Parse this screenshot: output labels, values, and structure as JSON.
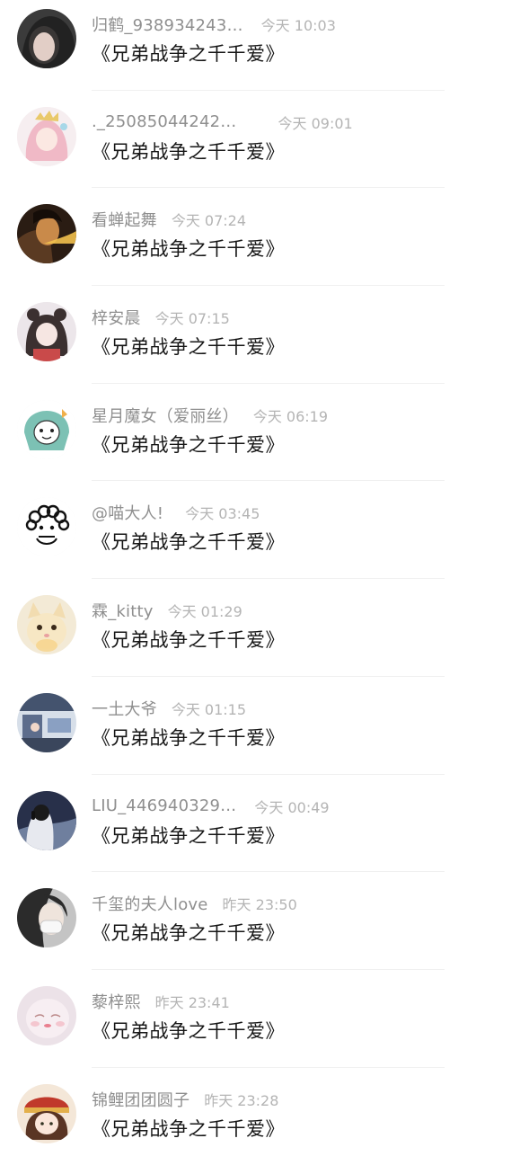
{
  "messages": [
    {
      "name": "归鹤_938934243…",
      "time": "今天 10:03",
      "text": "《兄弟战争之千千爱》",
      "avatar": "photo-dark-hair",
      "avatar_bg": "#3a3a3a",
      "avatar_fg": "#d9c7c0",
      "time_gap": 20
    },
    {
      "name": "._25085044242…",
      "time": "今天 09:01",
      "text": "《兄弟战争之千千爱》",
      "avatar": "anime-pink-hair",
      "avatar_bg": "#f4e6ea",
      "avatar_fg": "#e8a9b8",
      "time_gap": 46
    },
    {
      "name": "看蝉起舞",
      "time": "今天 07:24",
      "text": "《兄弟战争之千千爱》",
      "avatar": "photo-warm-light",
      "avatar_bg": "#2b1d14",
      "avatar_fg": "#e8b24a",
      "time_gap": 16
    },
    {
      "name": "梓安晨",
      "time": "今天 07:15",
      "text": "《兄弟战争之千千爱》",
      "avatar": "anime-bear-hat",
      "avatar_bg": "#e9e3e6",
      "avatar_fg": "#4a3c3c",
      "time_gap": 16
    },
    {
      "name": "星月魔女（爱丽丝）",
      "time": "今天 06:19",
      "text": "《兄弟战争之千千爱》",
      "avatar": "cartoon-teal",
      "avatar_bg": "#ffffff",
      "avatar_fg": "#7cc1b4",
      "time_gap": 16
    },
    {
      "name": "@喵大人!",
      "time": "今天 03:45",
      "text": "《兄弟战争之千千爱》",
      "avatar": "sketch-curly-hair",
      "avatar_bg": "#ffffff",
      "avatar_fg": "#111111",
      "time_gap": 24
    },
    {
      "name": "霖_kitty",
      "time": "今天 01:29",
      "text": "《兄弟战争之千千爱》",
      "avatar": "photo-white-cat",
      "avatar_bg": "#f3ead6",
      "avatar_fg": "#f6d38a",
      "time_gap": 16
    },
    {
      "name": "一土大爷",
      "time": "今天 01:15",
      "text": "《兄弟战争之千千爱》",
      "avatar": "illustration-room",
      "avatar_bg": "#5a6a88",
      "avatar_fg": "#c8d3e6",
      "time_gap": 16
    },
    {
      "name": "LIU_446940329…",
      "time": "今天 00:49",
      "text": "《兄弟战争之千千爱》",
      "avatar": "photo-headphones",
      "avatar_bg": "#2c3346",
      "avatar_fg": "#8d99b4",
      "time_gap": 20
    },
    {
      "name": "千玺的夫人love",
      "time": "昨天 23:50",
      "text": "《兄弟战争之千千爱》",
      "avatar": "photo-masked-girl",
      "avatar_bg": "#bfbfbf",
      "avatar_fg": "#2a2a2a",
      "time_gap": 16
    },
    {
      "name": "藜梓熙",
      "time": "昨天 23:41",
      "text": "《兄弟战争之千千爱》",
      "avatar": "soft-pink-face",
      "avatar_bg": "#e9dbe3",
      "avatar_fg": "#f4c6cf",
      "time_gap": 16
    },
    {
      "name": "锦鲤团团圆子",
      "time": "昨天 23:28",
      "text": "《兄弟战争之千千爱》",
      "avatar": "anime-red-hat",
      "avatar_bg": "#f2e4d6",
      "avatar_fg": "#c0392b",
      "time_gap": 16
    }
  ]
}
